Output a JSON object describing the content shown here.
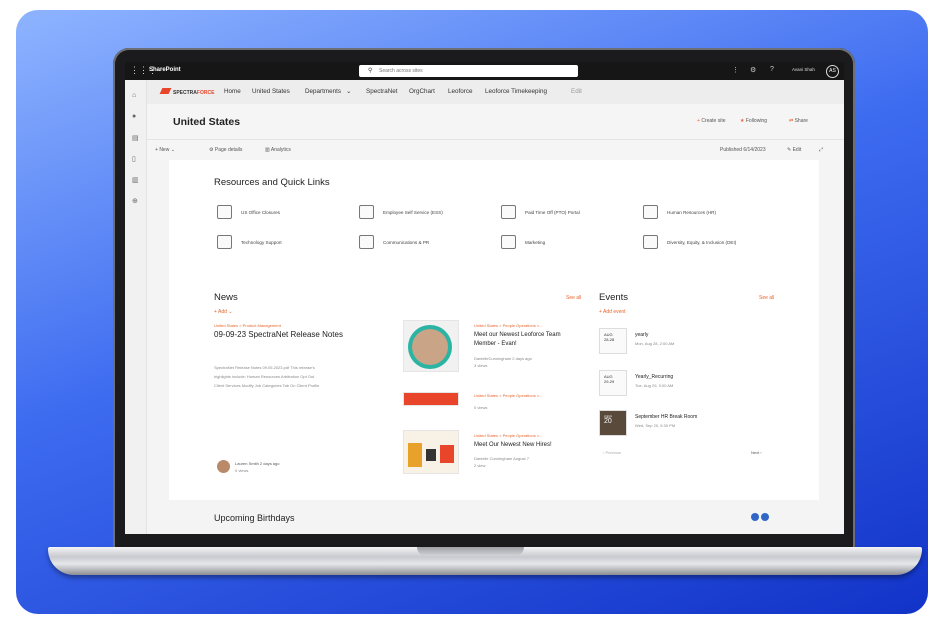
{
  "colors": {
    "accent": "#e8652b",
    "brand_red": "#e8452b",
    "suitebar": "#161616",
    "nav_blue": "#2f66c7"
  },
  "suite": {
    "app": "SharePoint",
    "search_placeholder": "Search across sites",
    "user": "Avani Shah",
    "initials": "AS"
  },
  "hub": {
    "logo_prefix": "SPECTRA",
    "logo_suffix": "FORCE",
    "items": [
      "Home",
      "United States",
      "Departments",
      "SpectraNet",
      "OrgChart",
      "Leoforce",
      "Leoforce Timekeeping",
      "Edit"
    ]
  },
  "site": {
    "title": "United States",
    "actions": {
      "create": "Create site",
      "follow": "Following",
      "share": "Share"
    }
  },
  "cmdbar": {
    "new": "New",
    "details": "Page details",
    "analytics": "Analytics",
    "published": "Published 6/14/2023",
    "edit": "Edit"
  },
  "quick_links": {
    "title": "Resources and Quick Links",
    "items": [
      "US Office Closures",
      "Employee Self Service (ESS)",
      "Paid Time Off (PTO) Portal",
      "Human Resources (HR)",
      "Technology Support",
      "Communications & PR",
      "Marketing",
      "Diversity, Equity, & Inclusion (DEI)"
    ]
  },
  "news": {
    "title": "News",
    "see_all": "See all",
    "add": "Add",
    "main": {
      "tag": "United States > Product Management",
      "title": "09-09-23 SpectraNet Release Notes",
      "excerpt_1": "SpectraNet Release Notes 09.05.2023.pdf This release's",
      "excerpt_2": "highlights include: Human Resources Arbitration Opt Out",
      "excerpt_3": "Client Services Modify Job Categories Tab On Client Profile",
      "author": "Lauren Smith 2 days ago",
      "views": "0 views"
    },
    "items": [
      {
        "tag": "United States > People Operations >...",
        "title_1": "Meet our Newest Leoforce Team",
        "title_2": "Member - Evan!",
        "meta": "DanielleCunningham 2 days ago",
        "views": "3 views"
      },
      {
        "tag": "United States > People Operations >...",
        "title_1": "",
        "title_2": "",
        "meta": "",
        "views": "0 views"
      },
      {
        "tag": "United States > People Operations >...",
        "title_1": "Meet Our Newest New Hires!",
        "title_2": "",
        "meta": "Danielle Cunningham August 7",
        "views": "2 view"
      }
    ]
  },
  "events": {
    "title": "Events",
    "see_all": "See all",
    "add": "Add event",
    "items": [
      {
        "month": "AUG",
        "day": "28-28",
        "title": "yearly",
        "when": "Mon, Aug 28, 2:00 AM"
      },
      {
        "month": "AUG",
        "day": "29-29",
        "title": "Yearly_Recurring",
        "when": "Tue, Aug 29, 3:00 AM"
      },
      {
        "month": "SEP",
        "day": "20",
        "title": "September HR Break Room",
        "when": "Wed, Sep 20, 5:30 PM"
      }
    ],
    "prev": "Previous",
    "next": "Next"
  },
  "birthdays": {
    "title": "Upcoming Birthdays"
  }
}
